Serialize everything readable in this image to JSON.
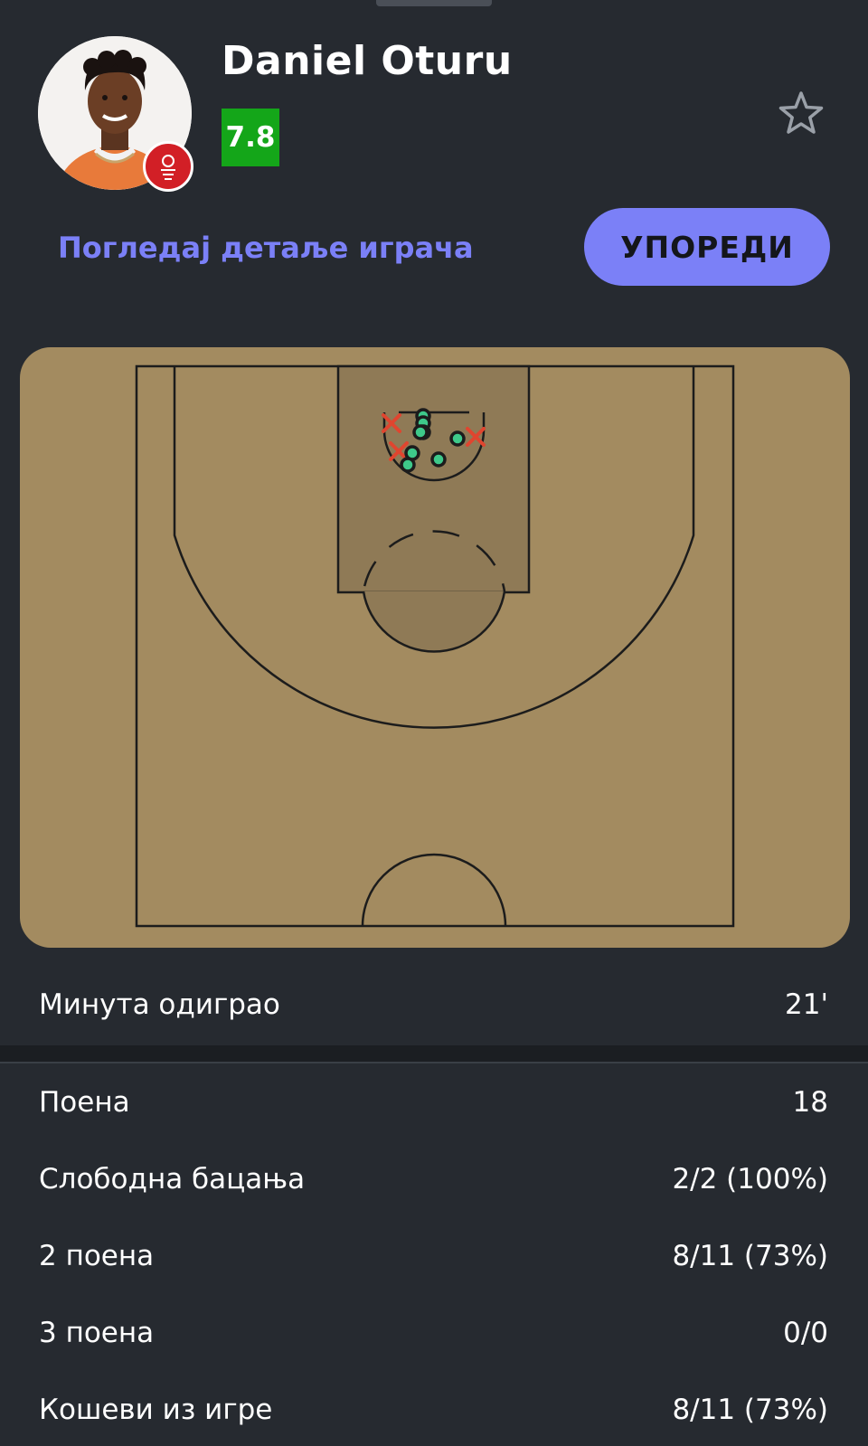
{
  "player": {
    "name": "Daniel Oturu",
    "rating": "7.8",
    "rating_color": "#14a619",
    "avatar_icon": "player-photo",
    "team_badge_icon": "team-logo-badge"
  },
  "actions": {
    "details_link": "Погледај детаље играча",
    "compare_label": "УПОРЕДИ",
    "favorite_icon": "star-outline-icon"
  },
  "colors": {
    "accent": "#7b80f7",
    "court": "#a38b60",
    "paint": "#8f7a56",
    "made_shot": "#3ec98a",
    "missed_shot": "#e0452f",
    "background": "#262a30"
  },
  "shot_chart": {
    "made_count": 8,
    "missed_count": 3,
    "made_marker": "circle",
    "missed_marker": "x"
  },
  "minutes": {
    "label": "Минута одиграо",
    "value": "21'"
  },
  "stats": [
    {
      "label": "Поена",
      "value": "18"
    },
    {
      "label": "Слободна бацања",
      "value": "2/2 (100%)"
    },
    {
      "label": "2 поена",
      "value": "8/11 (73%)"
    },
    {
      "label": "3 поена",
      "value": "0/0"
    },
    {
      "label": "Кошеви из игре",
      "value": "8/11 (73%)"
    }
  ]
}
